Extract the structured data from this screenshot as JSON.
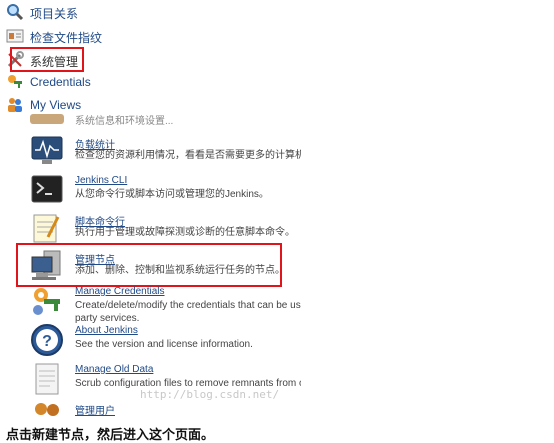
{
  "sidebar": {
    "items": [
      {
        "label": "项目关系",
        "icon": "search-icon"
      },
      {
        "label": "检查文件指纹",
        "icon": "fingerprint-icon"
      },
      {
        "label": "系统管理",
        "icon": "tools-icon"
      },
      {
        "label": "Credentials",
        "icon": "credentials-icon"
      },
      {
        "label": "My Views",
        "icon": "people-icon"
      }
    ]
  },
  "manage": {
    "partial_top": "系统信息和环境设置...",
    "items": [
      {
        "title": "负载统计",
        "desc": "检查您的资源利用情况，看看是否需要更多的计算机来",
        "icon": "monitor-icon"
      },
      {
        "title": "Jenkins CLI",
        "desc": "从您命令行或脚本访问或管理您的Jenkins。",
        "icon": "terminal-icon"
      },
      {
        "title": "脚本命令行",
        "desc": "执行用于管理或故障探测或诊断的任意脚本命令。",
        "icon": "notepad-icon"
      },
      {
        "title": "管理节点",
        "desc": "添加、删除、控制和监视系统运行任务的节点。",
        "icon": "computer-icon"
      },
      {
        "title": "Manage Credentials",
        "desc": "Create/delete/modify the credentials that can be used",
        "desc2": "party services.",
        "icon": "credentials-icon"
      },
      {
        "title": "About Jenkins",
        "desc": "See the version and license information.",
        "icon": "help-icon"
      },
      {
        "title": "Manage Old Data",
        "desc": "Scrub configuration files to remove remnants from old",
        "icon": "document-icon"
      },
      {
        "title": "管理用户",
        "desc": "",
        "icon": "users-icon"
      }
    ]
  },
  "watermark": "http://blog.csdn.net/",
  "caption": "点击新建节点，然后进入这个页面。",
  "colors": {
    "highlight": "#e0151b",
    "link": "#204a87"
  }
}
